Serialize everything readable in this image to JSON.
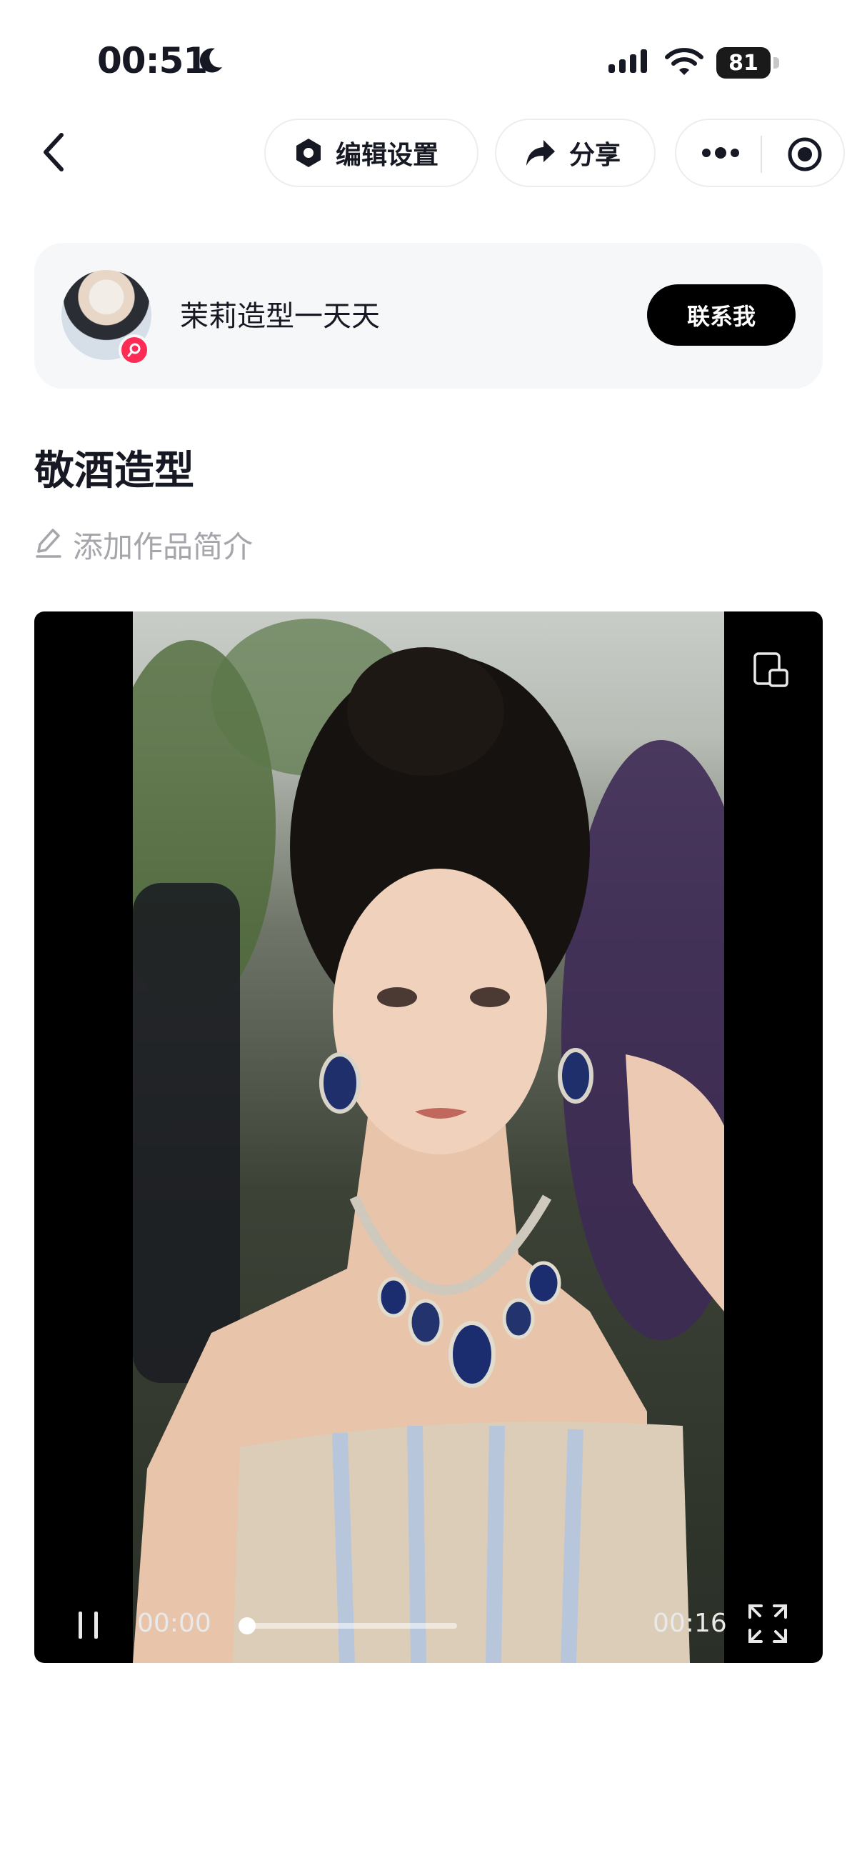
{
  "status_bar": {
    "time": "00:51",
    "battery": "81",
    "icons": [
      "moon-icon",
      "cellular-signal-icon",
      "wifi-icon",
      "battery-icon"
    ]
  },
  "nav": {
    "back_icon": "chevron-left-icon",
    "edit_settings_label": "编辑设置",
    "share_label": "分享",
    "more_icon": "more-dots-icon",
    "record_icon": "record-target-icon"
  },
  "author": {
    "name": "茉莉造型一天天",
    "contact_label": "联系我",
    "badge_icon": "search-badge-icon"
  },
  "post": {
    "title": "敬酒造型",
    "add_description": "添加作品简介"
  },
  "video": {
    "current_time": "00:00",
    "total_time": "00:16",
    "progress": 0.02,
    "controls_icons": [
      "pause-icon",
      "mini-window-icon",
      "fullscreen-icon"
    ]
  },
  "colors": {
    "accent": "#fe2c55",
    "text": "#161823",
    "muted": "#a5a6ab",
    "card_bg": "#f6f7f9"
  }
}
